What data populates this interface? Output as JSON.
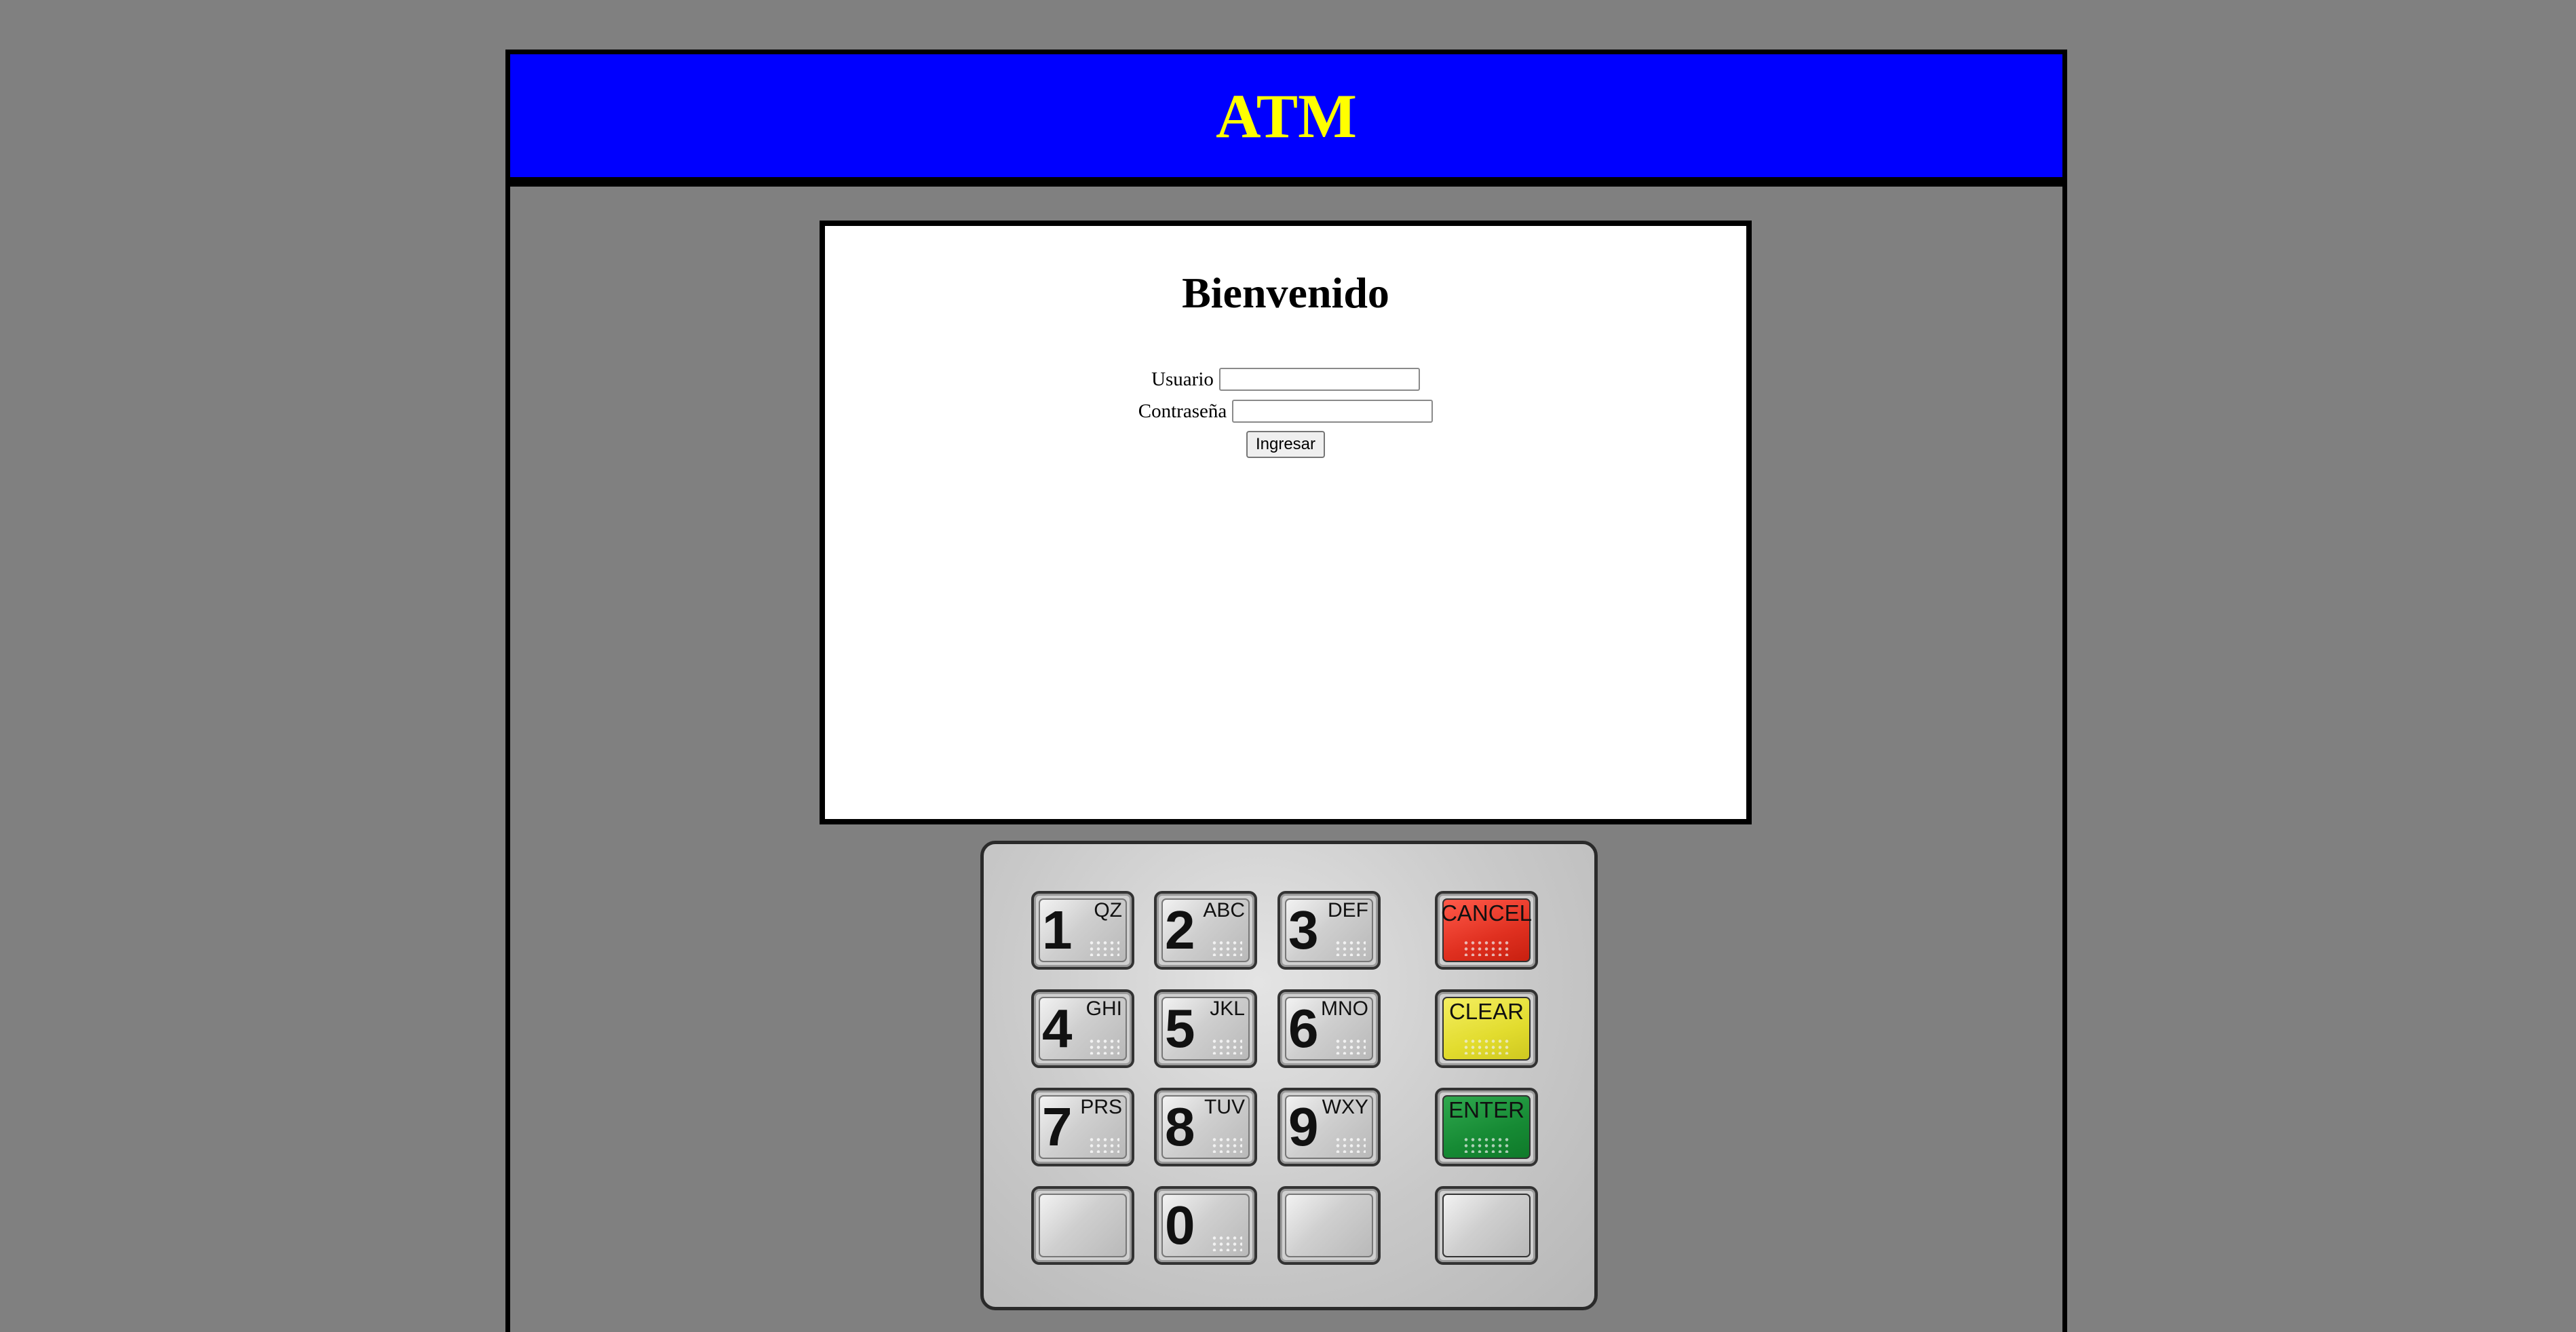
{
  "header": {
    "title": "ATM",
    "background_color": "#0000ff",
    "title_color": "#ffff00"
  },
  "screen": {
    "heading": "Bienvenido",
    "login_form": {
      "username_label": "Usuario",
      "username_value": "",
      "password_label": "Contraseña",
      "password_value": "",
      "submit_label": "Ingresar"
    }
  },
  "keypad": {
    "keys": [
      {
        "digit": "1",
        "letters": "QZ"
      },
      {
        "digit": "2",
        "letters": "ABC"
      },
      {
        "digit": "3",
        "letters": "DEF"
      },
      {
        "digit": "4",
        "letters": "GHI"
      },
      {
        "digit": "5",
        "letters": "JKL"
      },
      {
        "digit": "6",
        "letters": "MNO"
      },
      {
        "digit": "7",
        "letters": "PRS"
      },
      {
        "digit": "8",
        "letters": "TUV"
      },
      {
        "digit": "9",
        "letters": "WXY"
      },
      {
        "digit": "",
        "letters": ""
      },
      {
        "digit": "0",
        "letters": ""
      },
      {
        "digit": "",
        "letters": ""
      }
    ],
    "function_keys": {
      "cancel_label": "CANCEL",
      "clear_label": "CLEAR",
      "enter_label": "ENTER",
      "blank_label": ""
    },
    "colors": {
      "cancel": "#e03020",
      "clear": "#e2dc2e",
      "enter": "#168a34"
    }
  }
}
